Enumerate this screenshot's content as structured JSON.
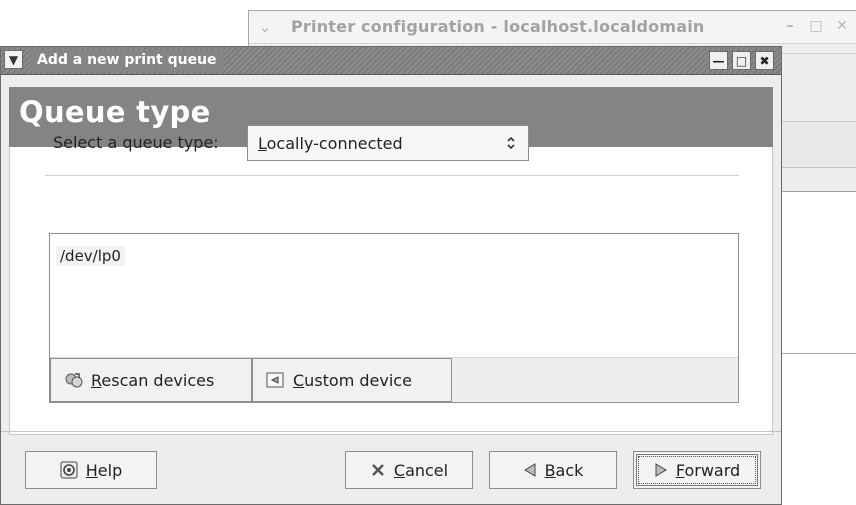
{
  "background_window": {
    "title": "Printer configuration - localhost.localdomain",
    "menu_icon": "chevron-down-icon",
    "controls": [
      "minimize-icon",
      "maximize-icon",
      "close-icon"
    ]
  },
  "dialog": {
    "title": "Add a new print queue",
    "menu_icon": "chevron-down-icon",
    "controls": {
      "minimize": "minimize-icon",
      "maximize": "maximize-icon",
      "close": "close-icon"
    }
  },
  "header": {
    "title": "Queue type"
  },
  "queue_type": {
    "label": "Select a queue type:",
    "selected_value": "Locally-connected",
    "selected_first_letter": "L",
    "selected_rest": "ocally-connected"
  },
  "devices": {
    "items": [
      "/dev/lp0"
    ],
    "buttons": {
      "rescan": {
        "mnemonic": "R",
        "rest": "escan devices",
        "icon": "rescan-icon"
      },
      "custom": {
        "mnemonic": "C",
        "rest": "ustom device",
        "icon": "custom-device-icon"
      }
    }
  },
  "footer": {
    "help": {
      "mnemonic": "H",
      "rest": "elp",
      "icon": "help-icon"
    },
    "cancel": {
      "mnemonic": "C",
      "rest": "ancel",
      "icon": "cancel-icon"
    },
    "back": {
      "mnemonic": "B",
      "rest": "ack",
      "icon": "back-arrow-icon"
    },
    "forward": {
      "mnemonic": "F",
      "rest": "orward",
      "icon": "forward-arrow-icon"
    }
  }
}
